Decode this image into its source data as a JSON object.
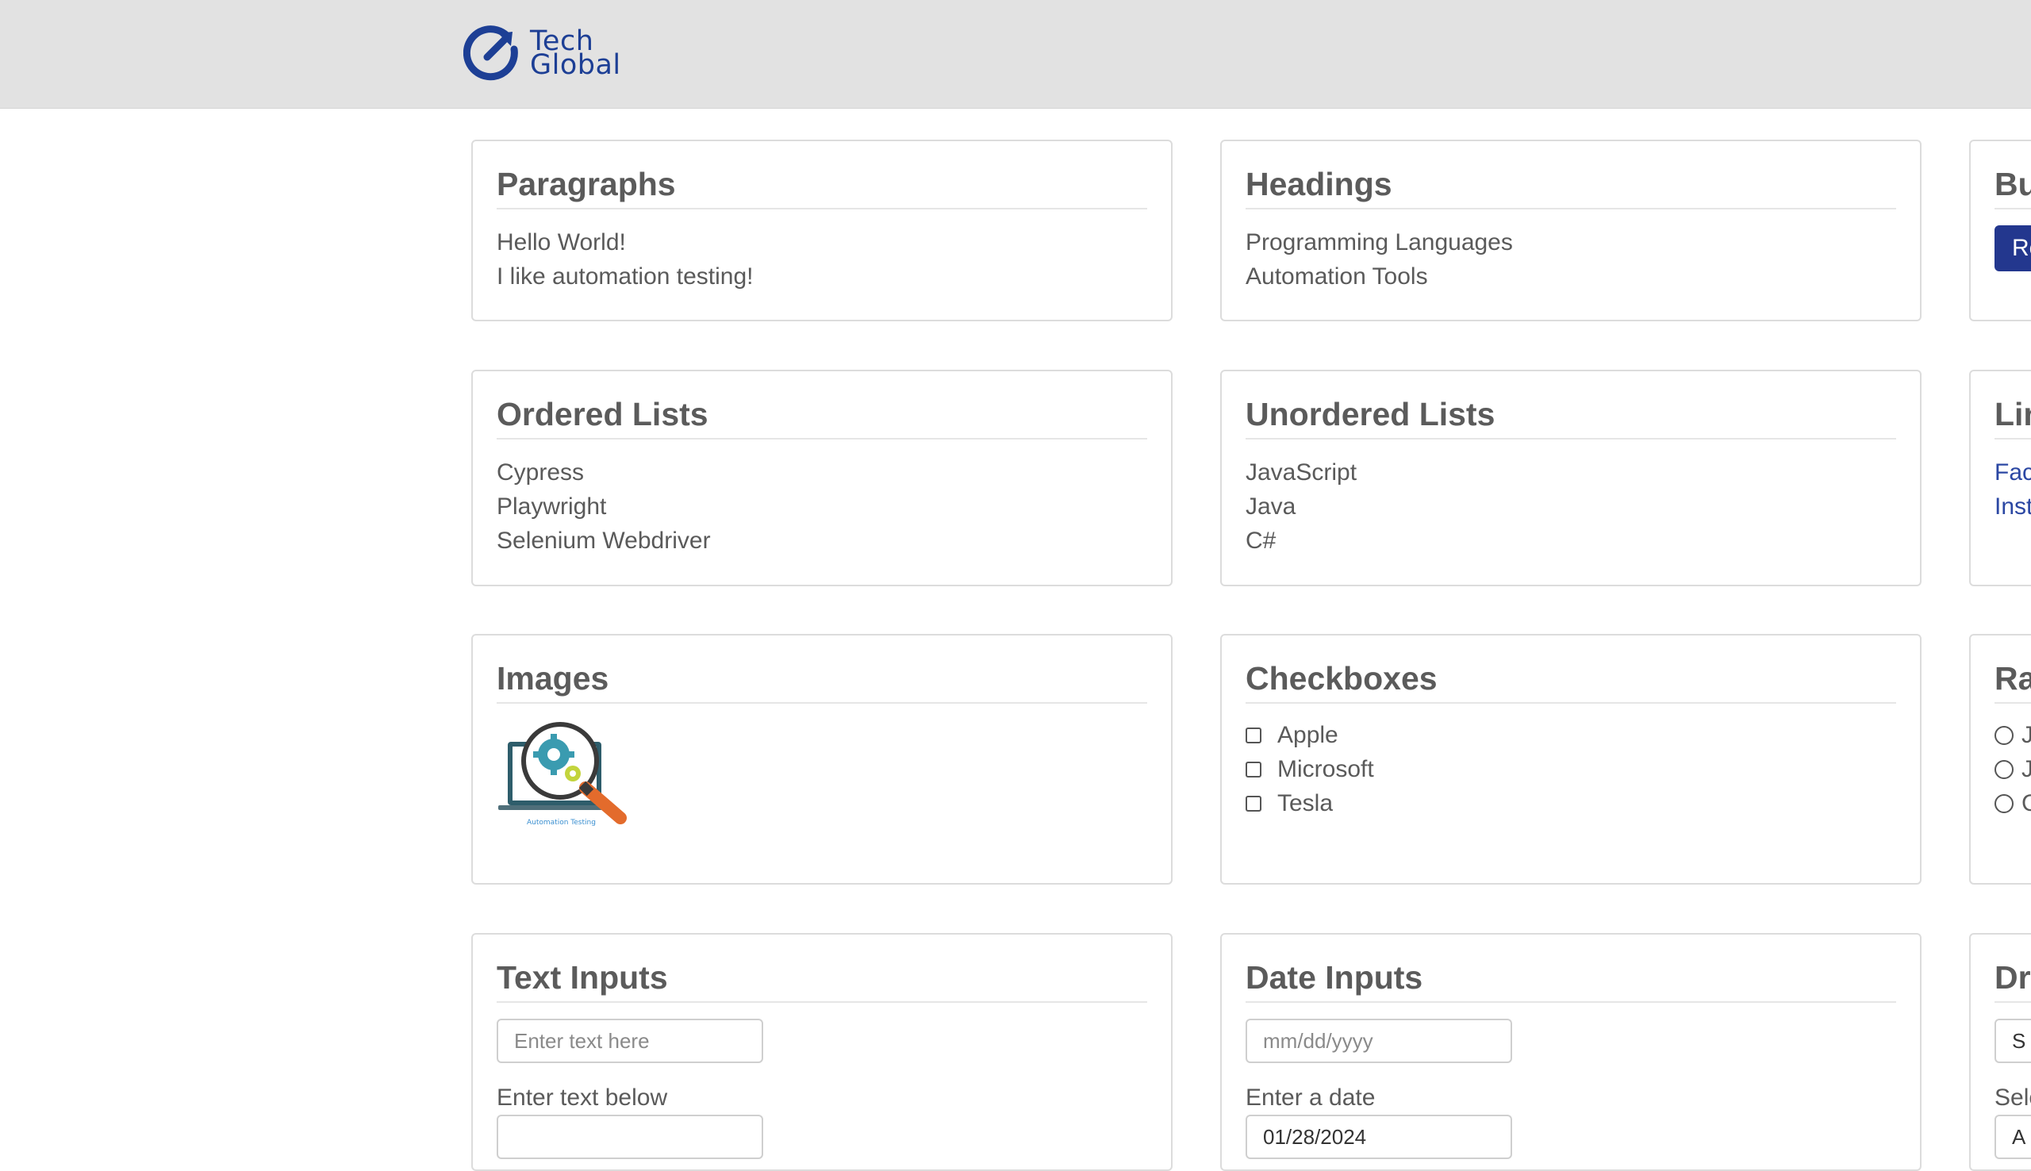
{
  "header": {
    "logo_line1": "Tech",
    "logo_line2": "Global",
    "logo_color": "#1d3f95"
  },
  "cards": {
    "paragraphs": {
      "title": "Paragraphs",
      "lines": [
        "Hello World!",
        "I like automation testing!"
      ]
    },
    "headings": {
      "title": "Headings",
      "lines": [
        "Programming Languages",
        "Automation Tools"
      ]
    },
    "buttons": {
      "title": "Bu",
      "button_label": "Re"
    },
    "ordered_lists": {
      "title": "Ordered Lists",
      "items": [
        "Cypress",
        "Playwright",
        "Selenium Webdriver"
      ]
    },
    "unordered_lists": {
      "title": "Unordered Lists",
      "items": [
        "JavaScript",
        "Java",
        "C#"
      ]
    },
    "links": {
      "title": "Lin",
      "items": [
        "Fac",
        "Inst"
      ]
    },
    "images": {
      "title": "Images",
      "image_caption": "Automation Testing"
    },
    "checkboxes": {
      "title": "Checkboxes",
      "items": [
        "Apple",
        "Microsoft",
        "Tesla"
      ]
    },
    "radio_buttons": {
      "title": "Ra",
      "items": [
        "J",
        "J",
        "C"
      ]
    },
    "text_inputs": {
      "title": "Text Inputs",
      "input_placeholder": "Enter text here",
      "second_label": "Enter text below"
    },
    "date_inputs": {
      "title": "Date Inputs",
      "input_placeholder": "mm/dd/yyyy",
      "second_label": "Enter a date",
      "second_value": "01/28/2024"
    },
    "dropdowns": {
      "title": "Dro",
      "first_value": "S",
      "second_label": "Sele",
      "second_value": "A"
    }
  },
  "colors": {
    "accent": "#23378e",
    "link": "#2b47a3",
    "header_bg": "#e2e2e2"
  }
}
